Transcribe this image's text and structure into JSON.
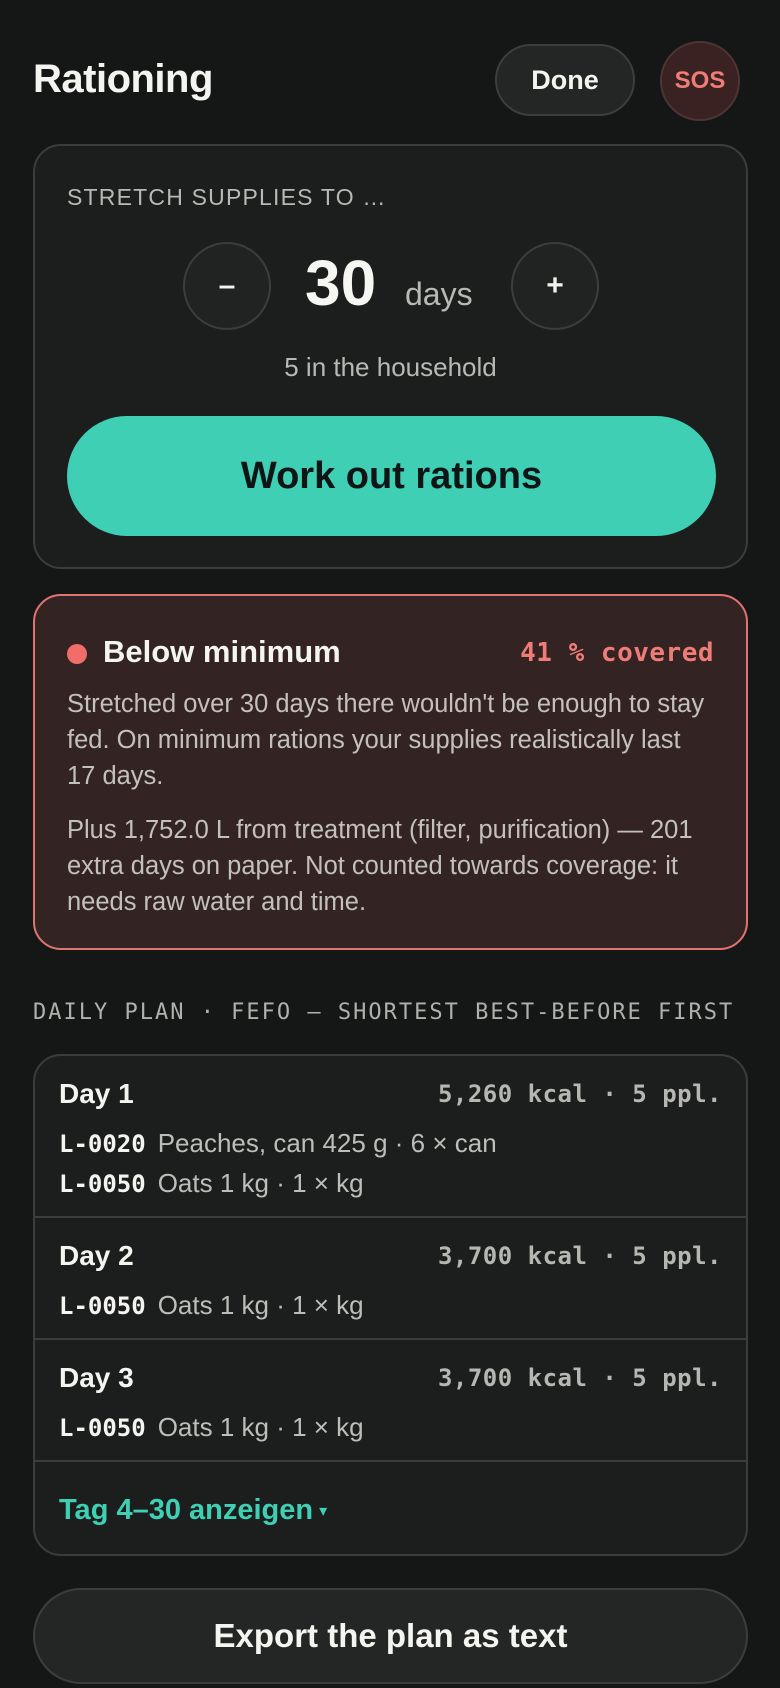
{
  "header": {
    "title": "Rationing",
    "done_label": "Done",
    "sos_label": "SOS"
  },
  "stretch": {
    "label": "STRETCH SUPPLIES TO …",
    "minus_label": "–",
    "plus_label": "+",
    "value": "30",
    "unit": "days",
    "household": "5 in the household",
    "action_label": "Work out rations"
  },
  "warning": {
    "title": "Below minimum",
    "coverage": "41 % covered",
    "text_1": "Stretched over 30 days there wouldn't be enough to stay fed. On minimum rations your supplies realistically last 17 days.",
    "text_2": "Plus 1,752.0 L from treatment (filter, purification) — 201 extra days on paper. Not counted towards coverage: it needs raw water and time.",
    "color": "#f06d6a"
  },
  "plan": {
    "section_label": "DAILY PLAN · FEFO — SHORTEST BEST-BEFORE FIRST",
    "days": [
      {
        "title": "Day 1",
        "kcal": "5,260 kcal · 5 ppl.",
        "items": [
          {
            "lot": "L-0020",
            "desc": "Peaches, can 425 g · 6 × can"
          },
          {
            "lot": "L-0050",
            "desc": "Oats 1 kg · 1 × kg"
          }
        ]
      },
      {
        "title": "Day 2",
        "kcal": "3,700 kcal · 5 ppl.",
        "items": [
          {
            "lot": "L-0050",
            "desc": "Oats 1 kg · 1 × kg"
          }
        ]
      },
      {
        "title": "Day 3",
        "kcal": "3,700 kcal · 5 ppl.",
        "items": [
          {
            "lot": "L-0050",
            "desc": "Oats 1 kg · 1 × kg"
          }
        ]
      }
    ],
    "show_more_label": "Tag 4–30 anzeigen",
    "show_more_caret": "▾"
  },
  "export_label": "Export the plan as text",
  "colors": {
    "accent": "#3ecfb5",
    "background": "#151616",
    "danger": "#f07c78"
  }
}
